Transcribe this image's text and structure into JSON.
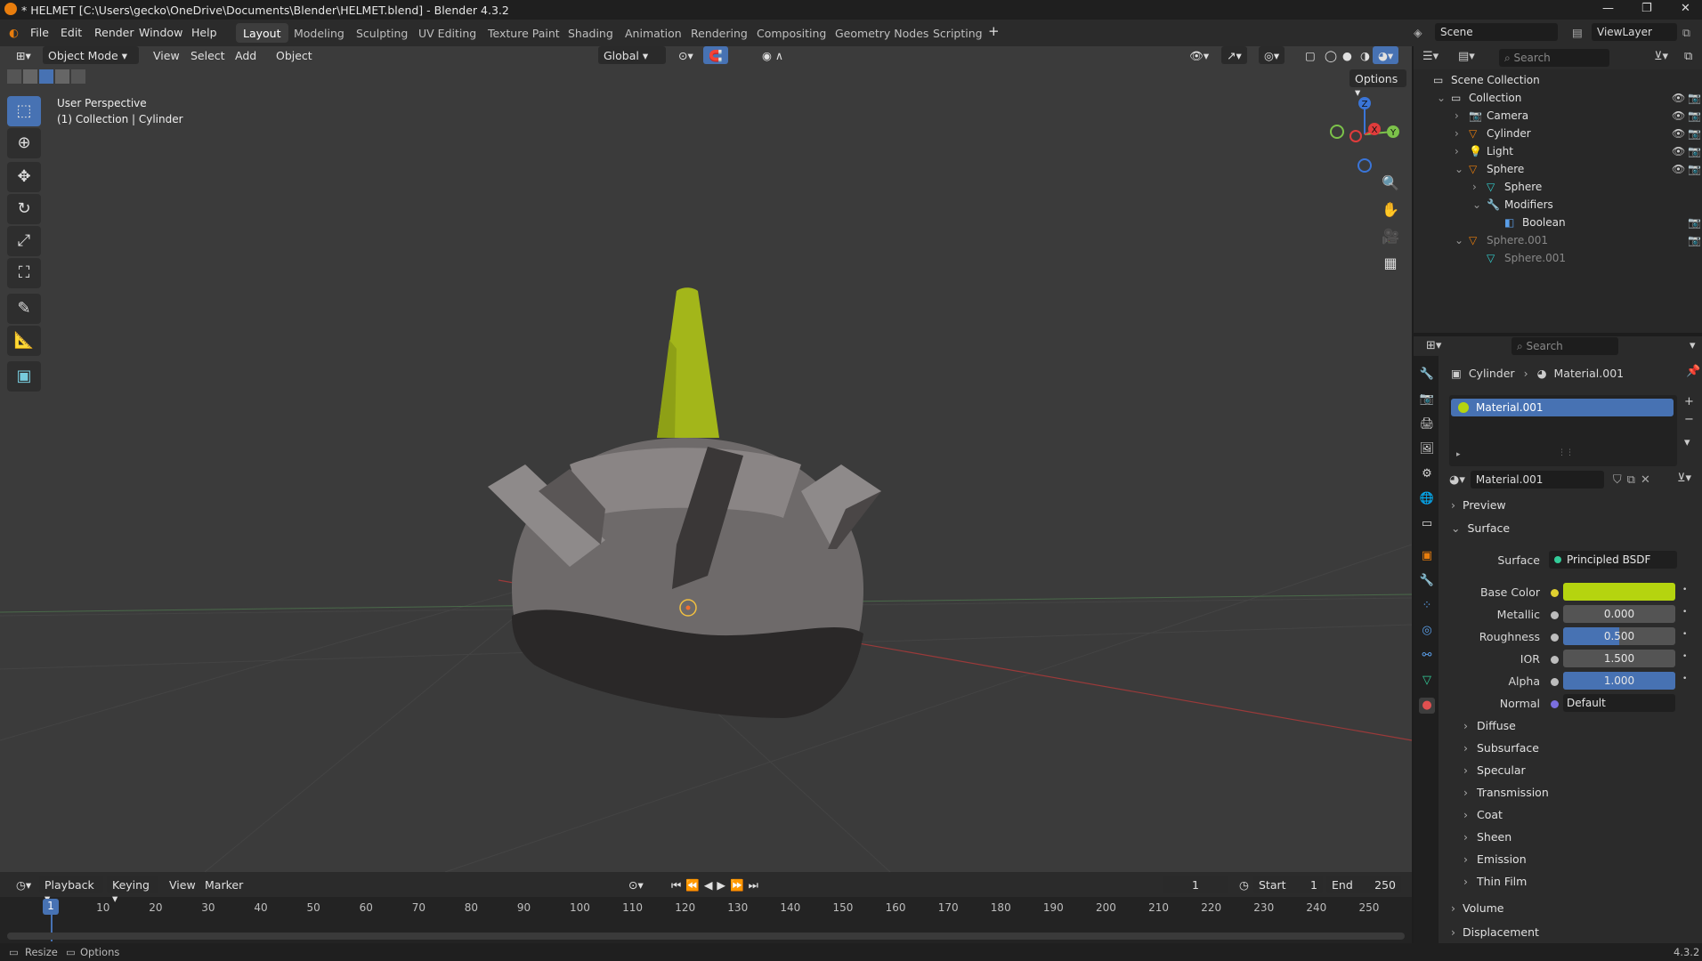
{
  "window": {
    "title": "* HELMET [C:\\Users\\gecko\\OneDrive\\Documents\\Blender\\HELMET.blend] - Blender 4.3.2",
    "controls": [
      "—",
      "❐",
      "✕"
    ]
  },
  "menu": [
    "File",
    "Edit",
    "Render",
    "Window",
    "Help"
  ],
  "workspaces": [
    "Layout",
    "Modeling",
    "Sculpting",
    "UV Editing",
    "Texture Paint",
    "Shading",
    "Animation",
    "Rendering",
    "Compositing",
    "Geometry Nodes",
    "Scripting"
  ],
  "active_workspace": "Layout",
  "scene": {
    "label": "Scene",
    "view_layer": "ViewLayer"
  },
  "viewport": {
    "mode": "Object Mode",
    "menus": [
      "View",
      "Select",
      "Add",
      "Object"
    ],
    "orientation": "Global",
    "options": "Options",
    "info_line1": "User Perspective",
    "info_line2": "(1) Collection | Cylinder",
    "tools": [
      "select-box",
      "cursor",
      "move",
      "rotate",
      "scale",
      "transform",
      "annotate",
      "measure",
      "add-cube"
    ],
    "gizmo": {
      "x": "X",
      "y": "Y",
      "z": "Z"
    }
  },
  "outliner": {
    "search_placeholder": "Search",
    "rows": [
      {
        "label": "Scene Collection",
        "indent": 0,
        "icon": "scene-collection-icon"
      },
      {
        "label": "Collection",
        "indent": 1,
        "icon": "collection-icon"
      },
      {
        "label": "Camera",
        "indent": 2,
        "icon": "camera-icon"
      },
      {
        "label": "Cylinder",
        "indent": 2,
        "icon": "mesh-object-icon"
      },
      {
        "label": "Light",
        "indent": 2,
        "icon": "light-icon"
      },
      {
        "label": "Sphere",
        "indent": 2,
        "icon": "mesh-object-icon"
      },
      {
        "label": "Sphere",
        "indent": 3,
        "icon": "mesh-data-icon"
      },
      {
        "label": "Modifiers",
        "indent": 3,
        "icon": "wrench-icon"
      },
      {
        "label": "Boolean",
        "indent": 4,
        "icon": "boolean-modifier-icon"
      },
      {
        "label": "Sphere.001",
        "indent": 2,
        "icon": "mesh-object-icon"
      },
      {
        "label": "Sphere.001",
        "indent": 3,
        "icon": "mesh-data-icon"
      }
    ]
  },
  "properties": {
    "search_placeholder": "Search",
    "breadcrumb_object": "Cylinder",
    "breadcrumb_material": "Material.001",
    "slot": "Material.001",
    "material_name": "Material.001",
    "sections": {
      "preview": "Preview",
      "surface": "Surface"
    },
    "surface": {
      "label": "Surface",
      "shader": "Principled BSDF",
      "base_color_label": "Base Color",
      "base_color": "#b5d40f",
      "metallic_label": "Metallic",
      "metallic": "0.000",
      "roughness_label": "Roughness",
      "roughness": "0.500",
      "roughness_fraction": 0.5,
      "ior_label": "IOR",
      "ior": "1.500",
      "alpha_label": "Alpha",
      "alpha": "1.000",
      "alpha_fraction": 1.0,
      "normal_label": "Normal",
      "normal": "Default"
    },
    "subsections": [
      "Diffuse",
      "Subsurface",
      "Specular",
      "Transmission",
      "Coat",
      "Sheen",
      "Emission",
      "Thin Film"
    ],
    "bottom_sections": [
      "Volume",
      "Displacement"
    ]
  },
  "timeline": {
    "menus": [
      "Playback",
      "Keying",
      "View",
      "Marker"
    ],
    "current_frame": "1",
    "start_label": "Start",
    "start": "1",
    "end_label": "End",
    "end": "250",
    "ticks": [
      "10",
      "20",
      "30",
      "40",
      "50",
      "60",
      "70",
      "80",
      "90",
      "100",
      "110",
      "120",
      "130",
      "140",
      "150",
      "160",
      "170",
      "180",
      "190",
      "200",
      "210",
      "220",
      "230",
      "240",
      "250"
    ],
    "playhead": "1"
  },
  "statusbar": {
    "left1": "Resize",
    "left2": "Options",
    "version": "4.3.2"
  },
  "colors": {
    "accent": "#4772b3",
    "header": "#2b2b2b",
    "viewport_bg": "#3b3b3b",
    "helmet_spike": "#a3b61a"
  }
}
